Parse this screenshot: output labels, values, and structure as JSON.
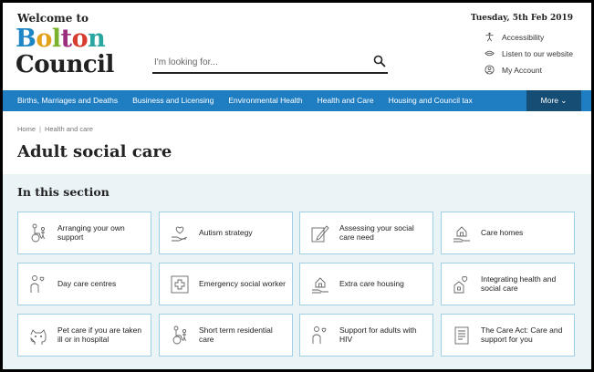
{
  "header": {
    "welcome": "Welcome to",
    "logo_letters": [
      "B",
      "o",
      "l",
      "t",
      "o",
      "n"
    ],
    "logo_line2": "Council",
    "date": "Tuesday, 5th Feb 2019",
    "search_placeholder": "I'm looking for...",
    "utilities": [
      {
        "label": "Accessibility",
        "icon": "accessibility-icon"
      },
      {
        "label": "Listen to our website",
        "icon": "listen-icon"
      },
      {
        "label": "My Account",
        "icon": "account-icon"
      }
    ]
  },
  "nav": {
    "items": [
      "Births, Marriages and Deaths",
      "Business and Licensing",
      "Environmental Health",
      "Health and Care",
      "Housing and Council tax"
    ],
    "more": "More ⌄"
  },
  "breadcrumb": [
    "Home",
    "Health and care"
  ],
  "page_title": "Adult social care",
  "section": {
    "title": "In this section",
    "cards": [
      {
        "label": "Arranging your own support",
        "icon": "wheelchair-person-icon"
      },
      {
        "label": "Autism strategy",
        "icon": "heart-hand-icon"
      },
      {
        "label": "Assessing your social care need",
        "icon": "pen-paper-icon"
      },
      {
        "label": "Care homes",
        "icon": "house-hand-icon"
      },
      {
        "label": "Day care centres",
        "icon": "person-heart-icon"
      },
      {
        "label": "Emergency social worker",
        "icon": "medical-cross-icon"
      },
      {
        "label": "Extra care housing",
        "icon": "house-hand-icon"
      },
      {
        "label": "Integrating health and social care",
        "icon": "heart-house-icon"
      },
      {
        "label": "Pet care if you are taken ill or in hospital",
        "icon": "pet-icon"
      },
      {
        "label": "Short term residential care",
        "icon": "wheelchair-person-icon"
      },
      {
        "label": "Support for adults with HIV",
        "icon": "person-heart-icon"
      },
      {
        "label": "The Care Act: Care and support for you",
        "icon": "document-icon"
      }
    ]
  },
  "colors": {
    "nav_blue": "#1f7dc2",
    "nav_more": "#164d74",
    "card_border": "#9fd0e8",
    "section_bg": "#eaf3f6",
    "icon_grey": "#666666"
  }
}
